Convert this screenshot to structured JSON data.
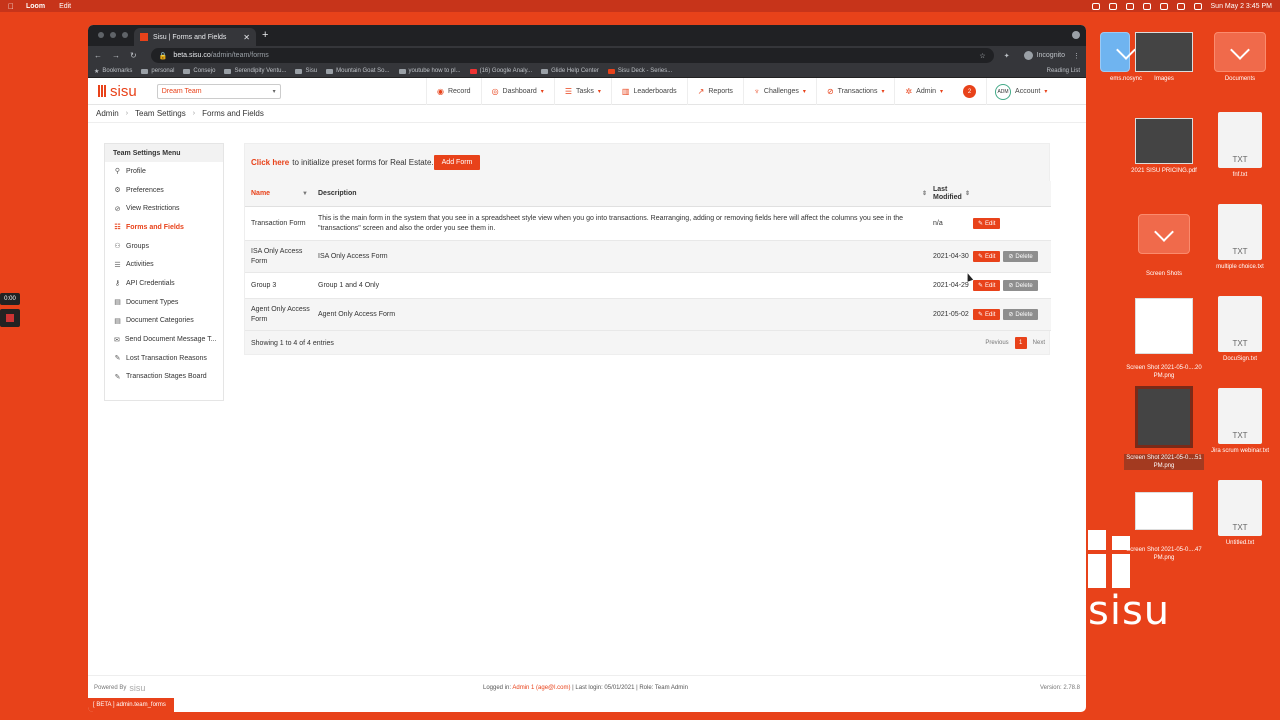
{
  "menubar": {
    "app": "Loom",
    "edit": "Edit",
    "datetime": "Sun May 2  3:45 PM"
  },
  "loom": {
    "timer": "0:00"
  },
  "desktop": {
    "items": [
      {
        "label": "ems.nosync"
      },
      {
        "label": "Images"
      },
      {
        "label": "Documents"
      },
      {
        "label": "2021 SISU PRICING.pdf"
      },
      {
        "label": "fnf.txt"
      },
      {
        "label": "Screen Shots"
      },
      {
        "label": "multiple choice.txt"
      },
      {
        "label": "Screen Shot 2021-05-0....20 PM.png"
      },
      {
        "label": "DocuSign.txt"
      },
      {
        "label": "Screen Shot 2021-05-0....51 PM.png"
      },
      {
        "label": "Jira scrum webinar.txt"
      },
      {
        "label": "Screen Shot 2021-05-0....47 PM.png"
      },
      {
        "label": "Untitled.txt"
      }
    ],
    "txt_badge": "TXT",
    "brand": "sisu"
  },
  "browser": {
    "tab_title": "Sisu | Forms and Fields",
    "url_host": "beta.sisu.co",
    "url_path": "/admin/team/forms",
    "incognito": "Incognito",
    "bookmarks": [
      "Bookmarks",
      "personal",
      "Consejo",
      "Serendipity Ventu...",
      "Sisu",
      "Mountain Goat So...",
      "youtube how to pl...",
      "(16) Google Analy...",
      "Glide Help Center",
      "Sisu Deck - Series..."
    ],
    "reading_list": "Reading List",
    "status": "[ BETA ] admin.team_forms"
  },
  "app": {
    "logo": "sisu",
    "team": "Dream Team",
    "nav": [
      {
        "label": "Record",
        "icon": "record-icon",
        "dropdown": false
      },
      {
        "label": "Dashboard",
        "icon": "dashboard-icon",
        "dropdown": true
      },
      {
        "label": "Tasks",
        "icon": "tasks-icon",
        "dropdown": true
      },
      {
        "label": "Leaderboards",
        "icon": "leaderboards-icon",
        "dropdown": false
      },
      {
        "label": "Reports",
        "icon": "reports-icon",
        "dropdown": false
      },
      {
        "label": "Challenges",
        "icon": "challenges-icon",
        "dropdown": true
      },
      {
        "label": "Transactions",
        "icon": "transactions-icon",
        "dropdown": true
      },
      {
        "label": "Admin",
        "icon": "admin-icon",
        "dropdown": true
      }
    ],
    "notifications": "2",
    "account": "Account",
    "avatar": "ADM"
  },
  "breadcrumb": [
    "Admin",
    "Team Settings",
    "Forms and Fields"
  ],
  "menu": {
    "title": "Team Settings Menu",
    "items": [
      "Profile",
      "Preferences",
      "View Restrictions",
      "Forms and Fields",
      "Groups",
      "Activities",
      "API Credentials",
      "Document Types",
      "Document Categories",
      "Send Document Message T...",
      "Lost Transaction Reasons",
      "Transaction Stages Board"
    ],
    "active_index": 3
  },
  "banner": {
    "link": "Click here",
    "text": "to initialize preset forms for Real Estate.",
    "button": "Add Form"
  },
  "table": {
    "columns": {
      "name": "Name",
      "description": "Description",
      "modified": "Last Modified"
    },
    "rows": [
      {
        "name": "Transaction Form",
        "description": "This is the main form in the system that you see in a spreadsheet style view when you go into transactions. Rearranging, adding or removing fields here will affect the columns you see in the \"transactions\" screen and also the order you see them in.",
        "modified": "n/a",
        "deletable": false
      },
      {
        "name": "ISA Only Access Form",
        "description": "ISA Only Access Form",
        "modified": "2021-04-30",
        "deletable": true
      },
      {
        "name": "Group 3",
        "description": "Group 1 and 4 Only",
        "modified": "2021-04-29",
        "deletable": true
      },
      {
        "name": "Agent Only Access Form",
        "description": "Agent Only Access Form",
        "modified": "2021-05-02",
        "deletable": true
      }
    ],
    "edit_label": "Edit",
    "delete_label": "Delete",
    "showing": "Showing 1 to 4 of 4 entries",
    "prev": "Previous",
    "page": "1",
    "next": "Next"
  },
  "footer": {
    "powered": "Powered By",
    "brand": "sisu",
    "logged_label": "Logged in:",
    "logged_user": "Admin 1 (age@l.com)",
    "last_login": "| Last login: 05/01/2021 | Role: Team Admin",
    "version": "Version: 2.78.8"
  }
}
